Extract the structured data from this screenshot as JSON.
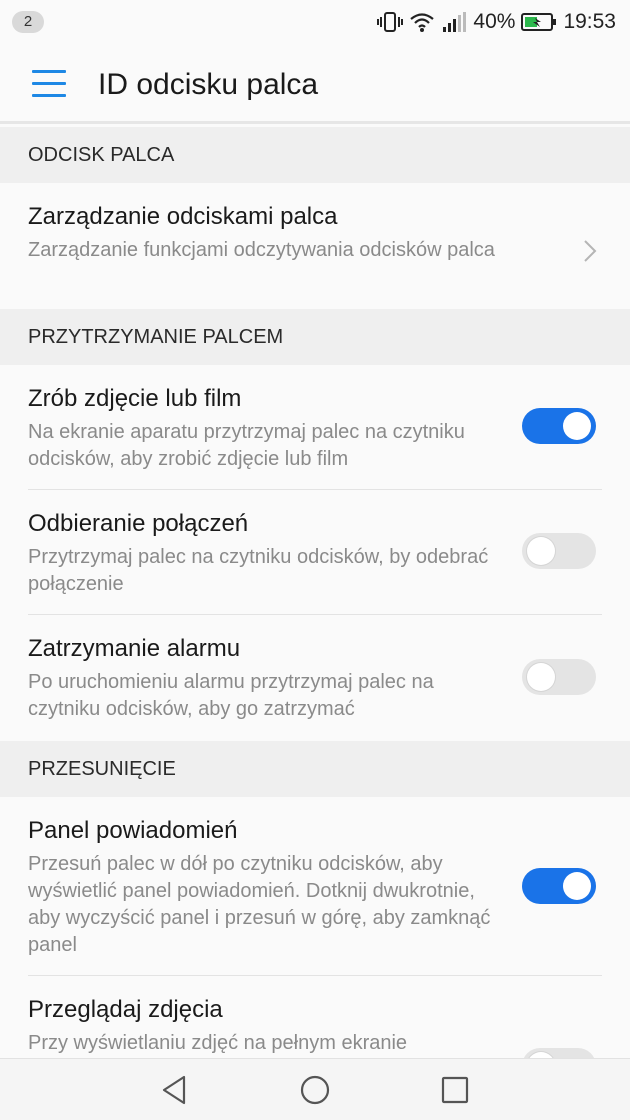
{
  "status_bar": {
    "notification_count": "2",
    "battery_percent": "40%",
    "time": "19:53",
    "icons": [
      "vibrate-icon",
      "wifi-icon",
      "signal-icon",
      "battery-charging-icon"
    ]
  },
  "toolbar": {
    "title": "ID odcisku palca",
    "menu_icon": "hamburger-menu-icon",
    "accent_color": "#1e88e5"
  },
  "sections": {
    "fingerprint": {
      "header": "ODCISK PALCA",
      "manage": {
        "title": "Zarządzanie odciskami palca",
        "subtitle": "Zarządzanie funkcjami odczytywania odcisków palca"
      }
    },
    "hold": {
      "header": "PRZYTRZYMANIE PALCEM",
      "items": [
        {
          "title": "Zrób zdjęcie lub film",
          "subtitle": "Na ekranie aparatu przytrzymaj palec na czytniku odcisków, aby zrobić zdjęcie lub film",
          "enabled": true
        },
        {
          "title": "Odbieranie połączeń",
          "subtitle": "Przytrzymaj palec na czytniku odcisków, by odebrać połączenie",
          "enabled": false
        },
        {
          "title": "Zatrzymanie alarmu",
          "subtitle": "Po uruchomieniu alarmu przytrzymaj palec na czytniku odcisków, aby go zatrzymać",
          "enabled": false
        }
      ]
    },
    "swipe": {
      "header": "PRZESUNIĘCIE",
      "items": [
        {
          "title": "Panel powiadomień",
          "subtitle": "Przesuń palec w dół po czytniku odcisków, aby wyświetlić panel powiadomień. Dotknij dwukrotnie, aby wyczyścić panel i przesuń w górę, aby zamknąć panel",
          "enabled": true
        },
        {
          "title": "Przeglądaj zdjęcia",
          "subtitle": "Przy wyświetlaniu zdjęć na pełnym ekranie",
          "enabled": false
        }
      ]
    }
  },
  "nav_bar": {
    "buttons": [
      "back-icon",
      "home-icon",
      "recents-icon"
    ]
  },
  "colors": {
    "toggle_on": "#1a73e8",
    "toggle_off": "#e4e4e4",
    "section_bg": "#efefef"
  }
}
